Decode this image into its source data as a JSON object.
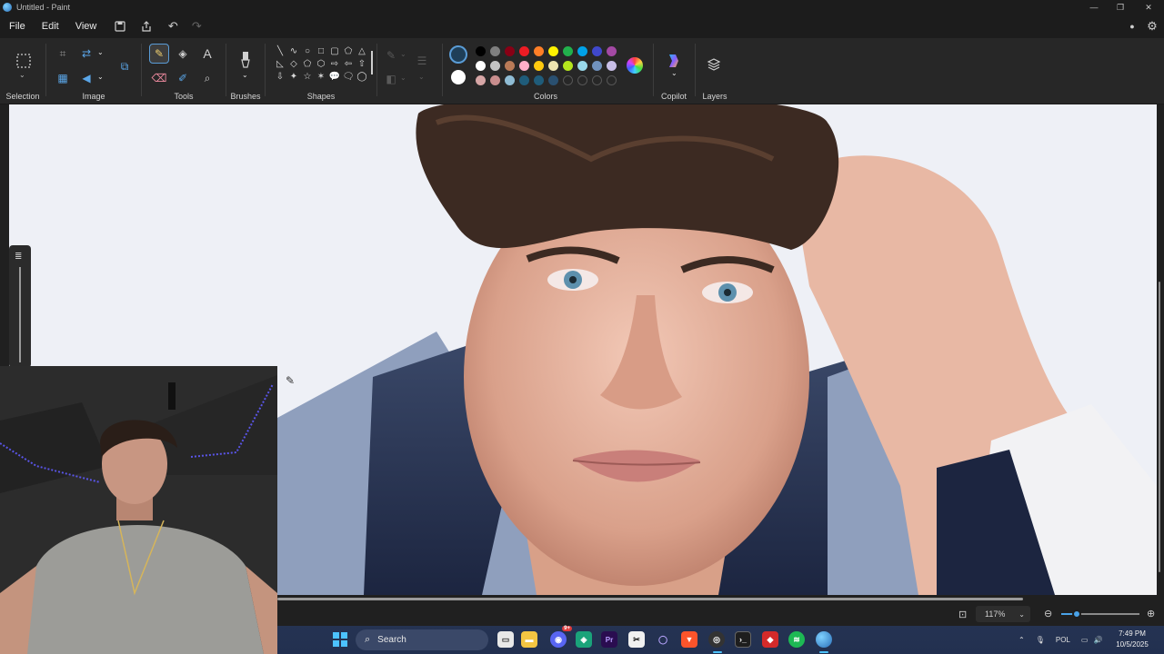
{
  "window": {
    "title": "Untitled - Paint",
    "controls": [
      "minimize-icon",
      "maximize-icon",
      "close-icon"
    ]
  },
  "menu": {
    "items": [
      "File",
      "Edit",
      "View"
    ],
    "quick_actions": [
      "save-icon",
      "share-icon",
      "undo-icon",
      "redo-icon"
    ],
    "right_icons": [
      "account-icon",
      "settings-icon"
    ]
  },
  "ribbon": {
    "groups": {
      "selection": "Selection",
      "image": "Image",
      "tools": "Tools",
      "brushes": "Brushes",
      "shapes": "Shapes",
      "colors": "Colors",
      "copilot": "Copilot",
      "layers": "Layers"
    },
    "shape_icons": [
      "╲",
      "∿",
      "○",
      "□",
      "▢",
      "⬠",
      "△",
      "◺",
      "◇",
      "⬠",
      "⬡",
      "⇨",
      "⇦",
      "⇧",
      "⇩",
      "✦",
      "☆",
      "✶",
      "💬",
      "🗨",
      "◯"
    ],
    "colors": {
      "primary": "#1f5c7a",
      "secondary": "#ffffff",
      "row1": [
        "#000000",
        "#7f7f7f",
        "#880015",
        "#ed1c24",
        "#ff7f27",
        "#fff200",
        "#22b14c",
        "#00a2e8",
        "#3f48cc",
        "#a349a4"
      ],
      "row2": [
        "#ffffff",
        "#c3c3c3",
        "#b97a57",
        "#ffaec9",
        "#ffc90e",
        "#efe4b0",
        "#b5e61d",
        "#99d9ea",
        "#7092be",
        "#c8bfe7"
      ],
      "row3": [
        "#d6a6a6",
        "#c98e8e",
        "#8fbcd4",
        "#1f5c7a",
        "#1f5c7a",
        "#2a5070"
      ]
    }
  },
  "status": {
    "zoom_value": "117%",
    "zoom_fraction": 0.15
  },
  "taskbar": {
    "search_label": "Search",
    "discord_badge": "9+",
    "language": "POL",
    "time": "7:49 PM",
    "date": "10/5/2025",
    "apps": [
      "start-icon",
      "task-view-icon",
      "file-explorer-icon",
      "discord-icon",
      "app-icon",
      "premiere-icon",
      "capcut-icon",
      "search-app-icon",
      "brave-icon",
      "obs-icon",
      "terminal-icon",
      "red-app-icon",
      "spotify-icon",
      "paint-icon"
    ]
  }
}
